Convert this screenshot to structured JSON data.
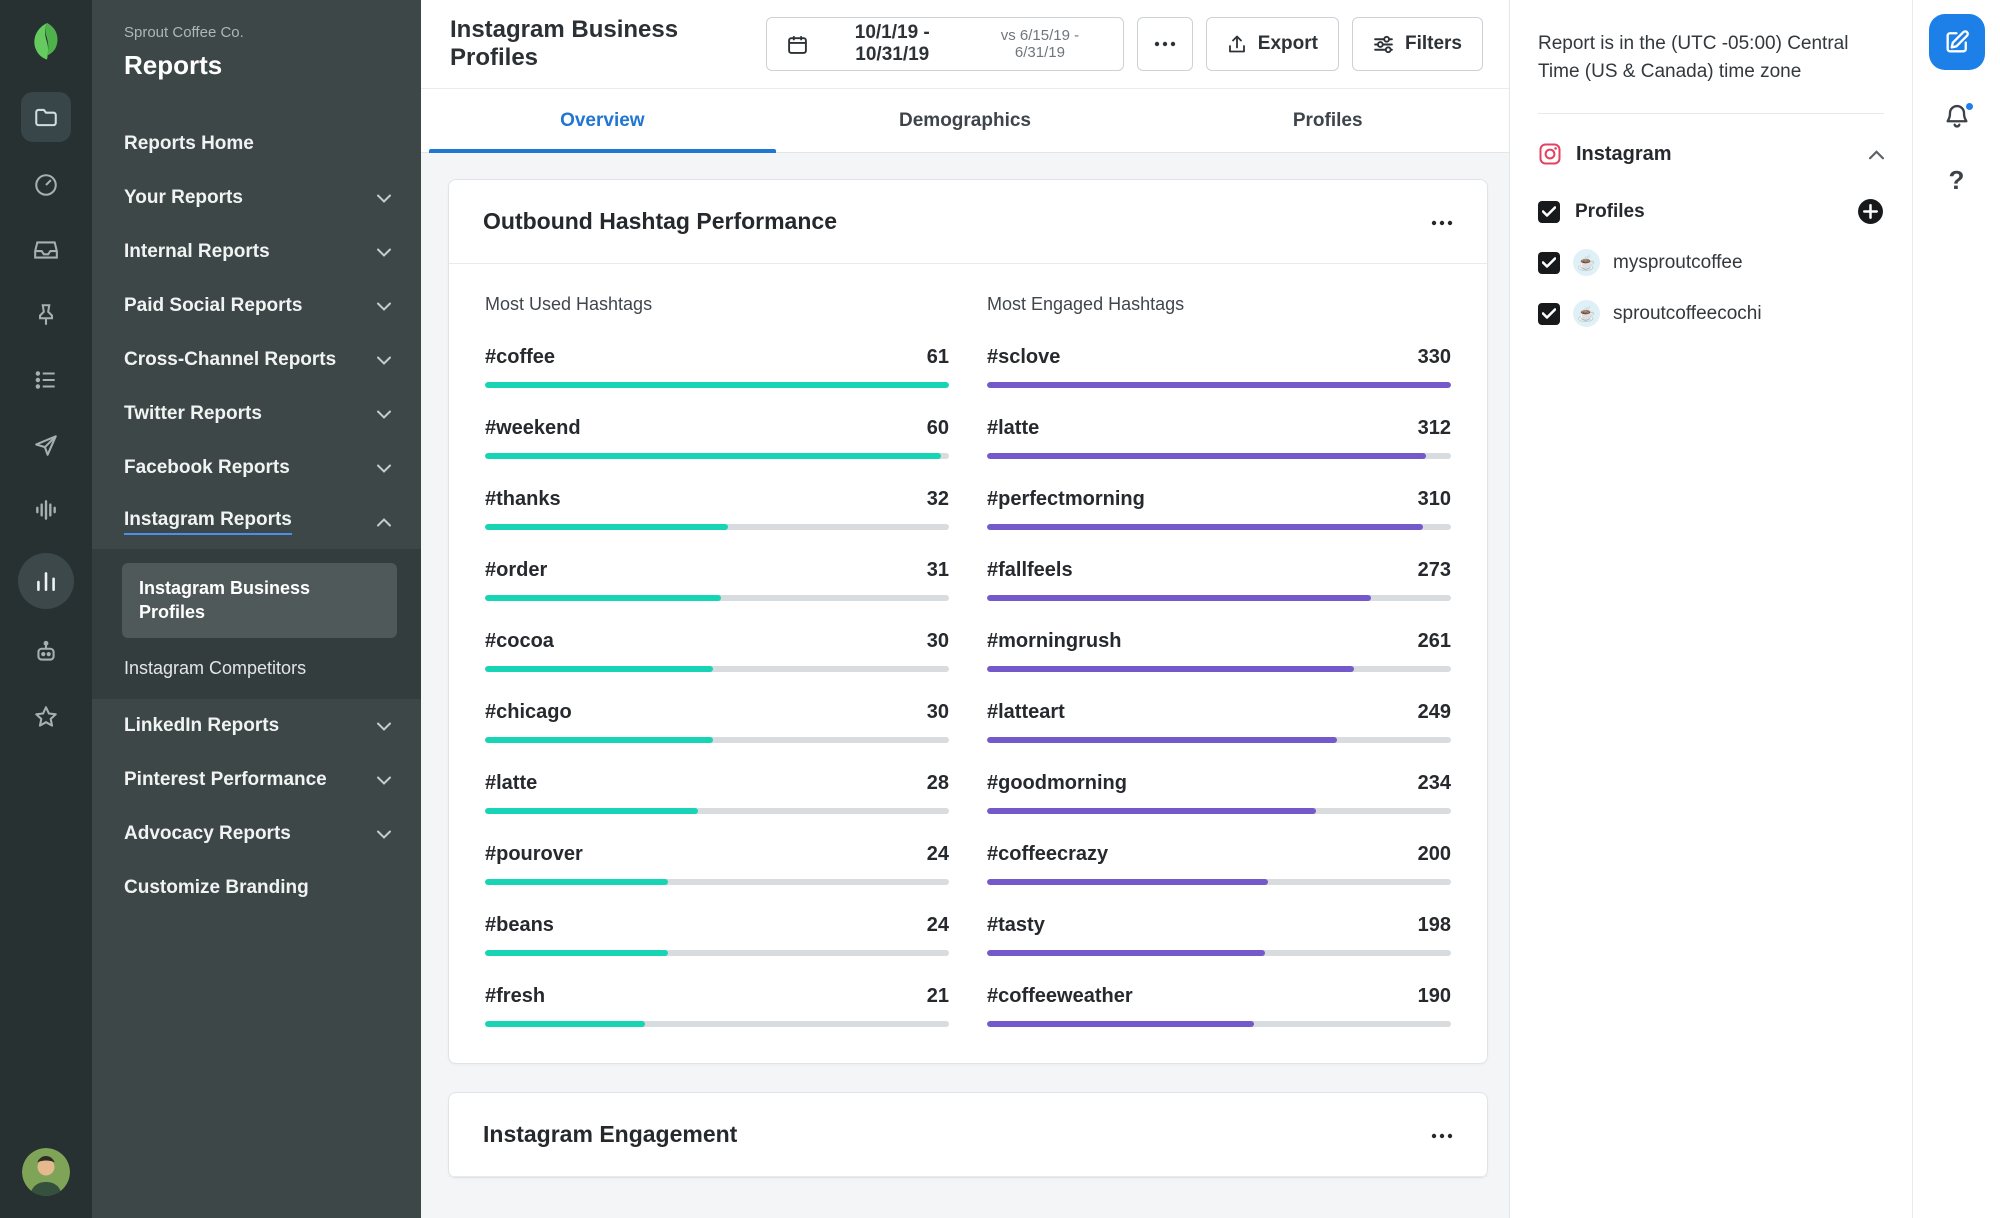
{
  "sidebar": {
    "company": "Sprout Coffee Co.",
    "title": "Reports",
    "items": [
      {
        "label": "Reports Home"
      },
      {
        "label": "Your Reports"
      },
      {
        "label": "Internal Reports"
      },
      {
        "label": "Paid Social Reports"
      },
      {
        "label": "Cross-Channel Reports"
      },
      {
        "label": "Twitter Reports"
      },
      {
        "label": "Facebook Reports"
      },
      {
        "label": "Instagram Reports"
      },
      {
        "label": "LinkedIn Reports"
      },
      {
        "label": "Pinterest Performance"
      },
      {
        "label": "Advocacy Reports"
      },
      {
        "label": "Customize Branding"
      }
    ],
    "submenu": [
      {
        "label": "Instagram Business Profiles",
        "selected": true
      },
      {
        "label": "Instagram Competitors",
        "selected": false
      }
    ]
  },
  "header": {
    "title": "Instagram Business Profiles",
    "date_range": "10/1/19 - 10/31/19",
    "compare_range": "vs 6/15/19 - 6/31/19",
    "export_label": "Export",
    "filters_label": "Filters"
  },
  "tabs": [
    {
      "label": "Overview",
      "active": true
    },
    {
      "label": "Demographics",
      "active": false
    },
    {
      "label": "Profiles",
      "active": false
    }
  ],
  "hashtag_card": {
    "title": "Outbound Hashtag Performance",
    "used_title": "Most Used Hashtags",
    "engaged_title": "Most Engaged Hashtags",
    "used": [
      {
        "tag": "#coffee",
        "value": 61
      },
      {
        "tag": "#weekend",
        "value": 60
      },
      {
        "tag": "#thanks",
        "value": 32
      },
      {
        "tag": "#order",
        "value": 31
      },
      {
        "tag": "#cocoa",
        "value": 30
      },
      {
        "tag": "#chicago",
        "value": 30
      },
      {
        "tag": "#latte",
        "value": 28
      },
      {
        "tag": "#pourover",
        "value": 24
      },
      {
        "tag": "#beans",
        "value": 24
      },
      {
        "tag": "#fresh",
        "value": 21
      }
    ],
    "engaged": [
      {
        "tag": "#sclove",
        "value": 330
      },
      {
        "tag": "#latte",
        "value": 312
      },
      {
        "tag": "#perfectmorning",
        "value": 310
      },
      {
        "tag": "#fallfeels",
        "value": 273
      },
      {
        "tag": "#morningrush",
        "value": 261
      },
      {
        "tag": "#latteart",
        "value": 249
      },
      {
        "tag": "#goodmorning",
        "value": 234
      },
      {
        "tag": "#coffeecrazy",
        "value": 200
      },
      {
        "tag": "#tasty",
        "value": 198
      },
      {
        "tag": "#coffeeweather",
        "value": 190
      }
    ]
  },
  "engagement_card": {
    "title": "Instagram Engagement"
  },
  "right_panel": {
    "timezone_note": "Report is in the (UTC -05:00) Central Time (US & Canada) time zone",
    "network": "Instagram",
    "profiles_label": "Profiles",
    "profiles": [
      {
        "name": "mysproutcoffee"
      },
      {
        "name": "sproutcoffeecochi"
      }
    ]
  },
  "colors": {
    "accent_blue": "#1d7fe8",
    "tab_blue": "#2276d3",
    "teal_bar": "#17d4b5",
    "purple_bar": "#7459cb",
    "instagram_red": "#e4405f",
    "sprout_green": "#66cb5e"
  }
}
